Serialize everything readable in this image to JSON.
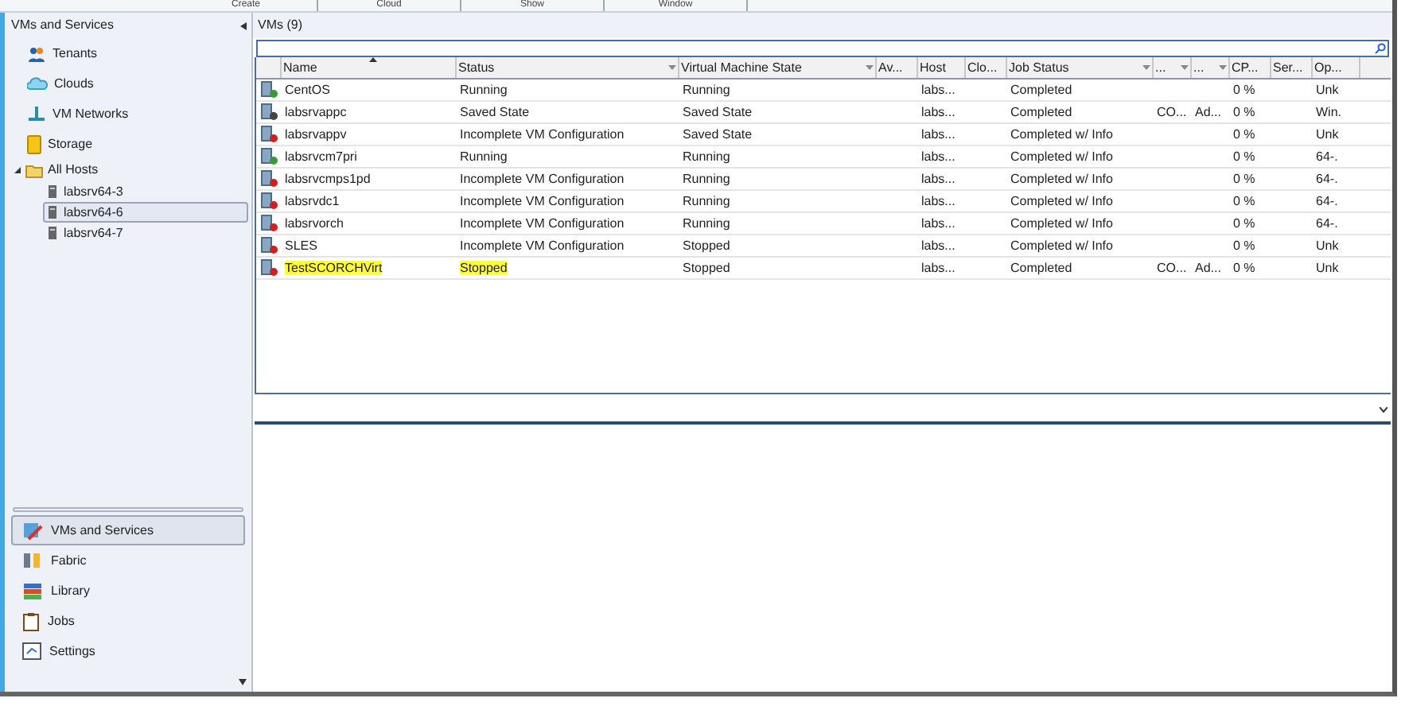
{
  "ribbon_groups": [
    "Create",
    "Cloud",
    "Show",
    "Window"
  ],
  "sidebar": {
    "title": "VMs and Services",
    "items": [
      {
        "label": "Tenants",
        "kind": "tenants"
      },
      {
        "label": "Clouds",
        "kind": "clouds"
      },
      {
        "label": "VM Networks",
        "kind": "networks"
      },
      {
        "label": "Storage",
        "kind": "storage"
      }
    ],
    "tree": {
      "label": "All Hosts",
      "expanded": true,
      "children": [
        {
          "label": "labsrv64-3",
          "selected": false
        },
        {
          "label": "labsrv64-6",
          "selected": true
        },
        {
          "label": "labsrv64-7",
          "selected": false
        }
      ]
    }
  },
  "workspaces": [
    {
      "label": "VMs and Services",
      "kind": "vms",
      "selected": true
    },
    {
      "label": "Fabric",
      "kind": "fabric",
      "selected": false
    },
    {
      "label": "Library",
      "kind": "library",
      "selected": false
    },
    {
      "label": "Jobs",
      "kind": "jobs",
      "selected": false
    },
    {
      "label": "Settings",
      "kind": "settings",
      "selected": false
    }
  ],
  "grid": {
    "title": "VMs (9)",
    "columns": [
      {
        "label": "Name",
        "sorted": true,
        "filter": false
      },
      {
        "label": "Status",
        "sorted": false,
        "filter": true
      },
      {
        "label": "Virtual Machine State",
        "sorted": false,
        "filter": true
      },
      {
        "label": "Av...",
        "sorted": false,
        "filter": false
      },
      {
        "label": "Host",
        "sorted": false,
        "filter": false
      },
      {
        "label": "Clo...",
        "sorted": false,
        "filter": false
      },
      {
        "label": "Job Status",
        "sorted": false,
        "filter": true
      },
      {
        "label": "...",
        "sorted": false,
        "filter": true
      },
      {
        "label": "...",
        "sorted": false,
        "filter": true
      },
      {
        "label": "CP...",
        "sorted": false,
        "filter": false
      },
      {
        "label": "Ser...",
        "sorted": false,
        "filter": false
      },
      {
        "label": "Op...",
        "sorted": false,
        "filter": false
      }
    ],
    "rows": [
      {
        "kind": "running",
        "highlighted": false,
        "cells": [
          "CentOS",
          "Running",
          "Running",
          "",
          "labs...",
          "",
          "Completed",
          "",
          "",
          "0 %",
          "",
          "Unk"
        ]
      },
      {
        "kind": "saved",
        "highlighted": false,
        "cells": [
          "labsrvappc",
          "Saved State",
          "Saved State",
          "",
          "labs...",
          "",
          "Completed",
          "CO...",
          "Ad...",
          "0 %",
          "",
          "Win."
        ]
      },
      {
        "kind": "error",
        "highlighted": false,
        "cells": [
          "labsrvappv",
          "Incomplete VM Configuration",
          "Saved State",
          "",
          "labs...",
          "",
          "Completed w/ Info",
          "",
          "",
          "0 %",
          "",
          "Unk"
        ]
      },
      {
        "kind": "running",
        "highlighted": false,
        "cells": [
          "labsrvcm7pri",
          "Running",
          "Running",
          "",
          "labs...",
          "",
          "Completed w/ Info",
          "",
          "",
          "0 %",
          "",
          "64-."
        ]
      },
      {
        "kind": "error",
        "highlighted": false,
        "cells": [
          "labsrvcmps1pd",
          "Incomplete VM Configuration",
          "Running",
          "",
          "labs...",
          "",
          "Completed w/ Info",
          "",
          "",
          "0 %",
          "",
          "64-."
        ]
      },
      {
        "kind": "error",
        "highlighted": false,
        "cells": [
          "labsrvdc1",
          "Incomplete VM Configuration",
          "Running",
          "",
          "labs...",
          "",
          "Completed w/ Info",
          "",
          "",
          "0 %",
          "",
          "64-."
        ]
      },
      {
        "kind": "error",
        "highlighted": false,
        "cells": [
          "labsrvorch",
          "Incomplete VM Configuration",
          "Running",
          "",
          "labs...",
          "",
          "Completed w/ Info",
          "",
          "",
          "0 %",
          "",
          "64-."
        ]
      },
      {
        "kind": "error",
        "highlighted": false,
        "cells": [
          "SLES",
          "Incomplete VM Configuration",
          "Stopped",
          "",
          "labs...",
          "",
          "Completed w/ Info",
          "",
          "",
          "0 %",
          "",
          "Unk"
        ]
      },
      {
        "kind": "error",
        "highlighted": true,
        "cells": [
          "TestSCORCHVirt",
          "Stopped",
          "Stopped",
          "",
          "labs...",
          "",
          "Completed",
          "CO...",
          "Ad...",
          "0 %",
          "",
          "Unk"
        ]
      }
    ]
  }
}
